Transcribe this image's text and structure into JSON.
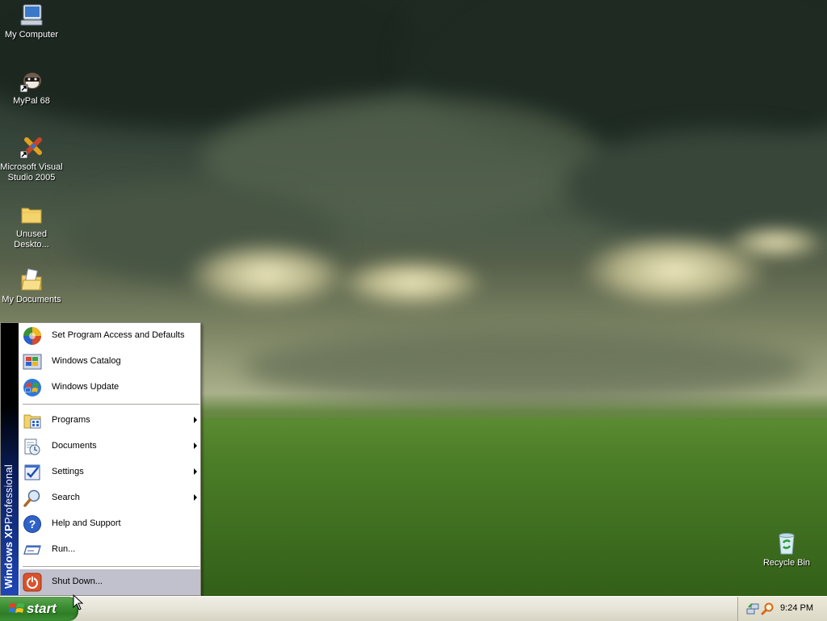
{
  "desktop": {
    "icons": [
      {
        "label": "My Computer",
        "icon": "my-computer-icon"
      },
      {
        "label": "MyPal 68",
        "icon": "mypal-icon"
      },
      {
        "label": "Microsoft Visual Studio 2005",
        "icon": "visual-studio-icon"
      },
      {
        "label": "Unused Deskto...",
        "icon": "folder-icon"
      },
      {
        "label": "My Documents",
        "icon": "my-documents-icon"
      },
      {
        "label": "Recycle Bin",
        "icon": "recycle-bin-icon"
      }
    ]
  },
  "start_menu": {
    "banner": {
      "brand": "Windows XP",
      "edition": "Professional"
    },
    "top_items": [
      {
        "label": "Set Program Access and Defaults",
        "icon": "program-access-icon"
      },
      {
        "label": "Windows Catalog",
        "icon": "windows-catalog-icon"
      },
      {
        "label": "Windows Update",
        "icon": "windows-update-icon"
      }
    ],
    "items": [
      {
        "label": "Programs",
        "icon": "programs-icon",
        "submenu": true
      },
      {
        "label": "Documents",
        "icon": "documents-icon",
        "submenu": true
      },
      {
        "label": "Settings",
        "icon": "settings-icon",
        "submenu": true
      },
      {
        "label": "Search",
        "icon": "search-icon",
        "submenu": true
      },
      {
        "label": "Help and Support",
        "icon": "help-icon",
        "submenu": false
      },
      {
        "label": "Run...",
        "icon": "run-icon",
        "submenu": false
      }
    ],
    "shutdown": {
      "label": "Shut Down...",
      "icon": "shutdown-icon",
      "selected": true
    }
  },
  "taskbar": {
    "start_label": "start",
    "clock": "9:24 PM",
    "tray_icons": [
      "network-icon",
      "search-tray-icon"
    ]
  },
  "colors": {
    "start_button": "#3c8f33",
    "taskbar": "#e6e3d7",
    "menu_banner": "#1e46b6",
    "selected_item": "#c1c0cd"
  }
}
